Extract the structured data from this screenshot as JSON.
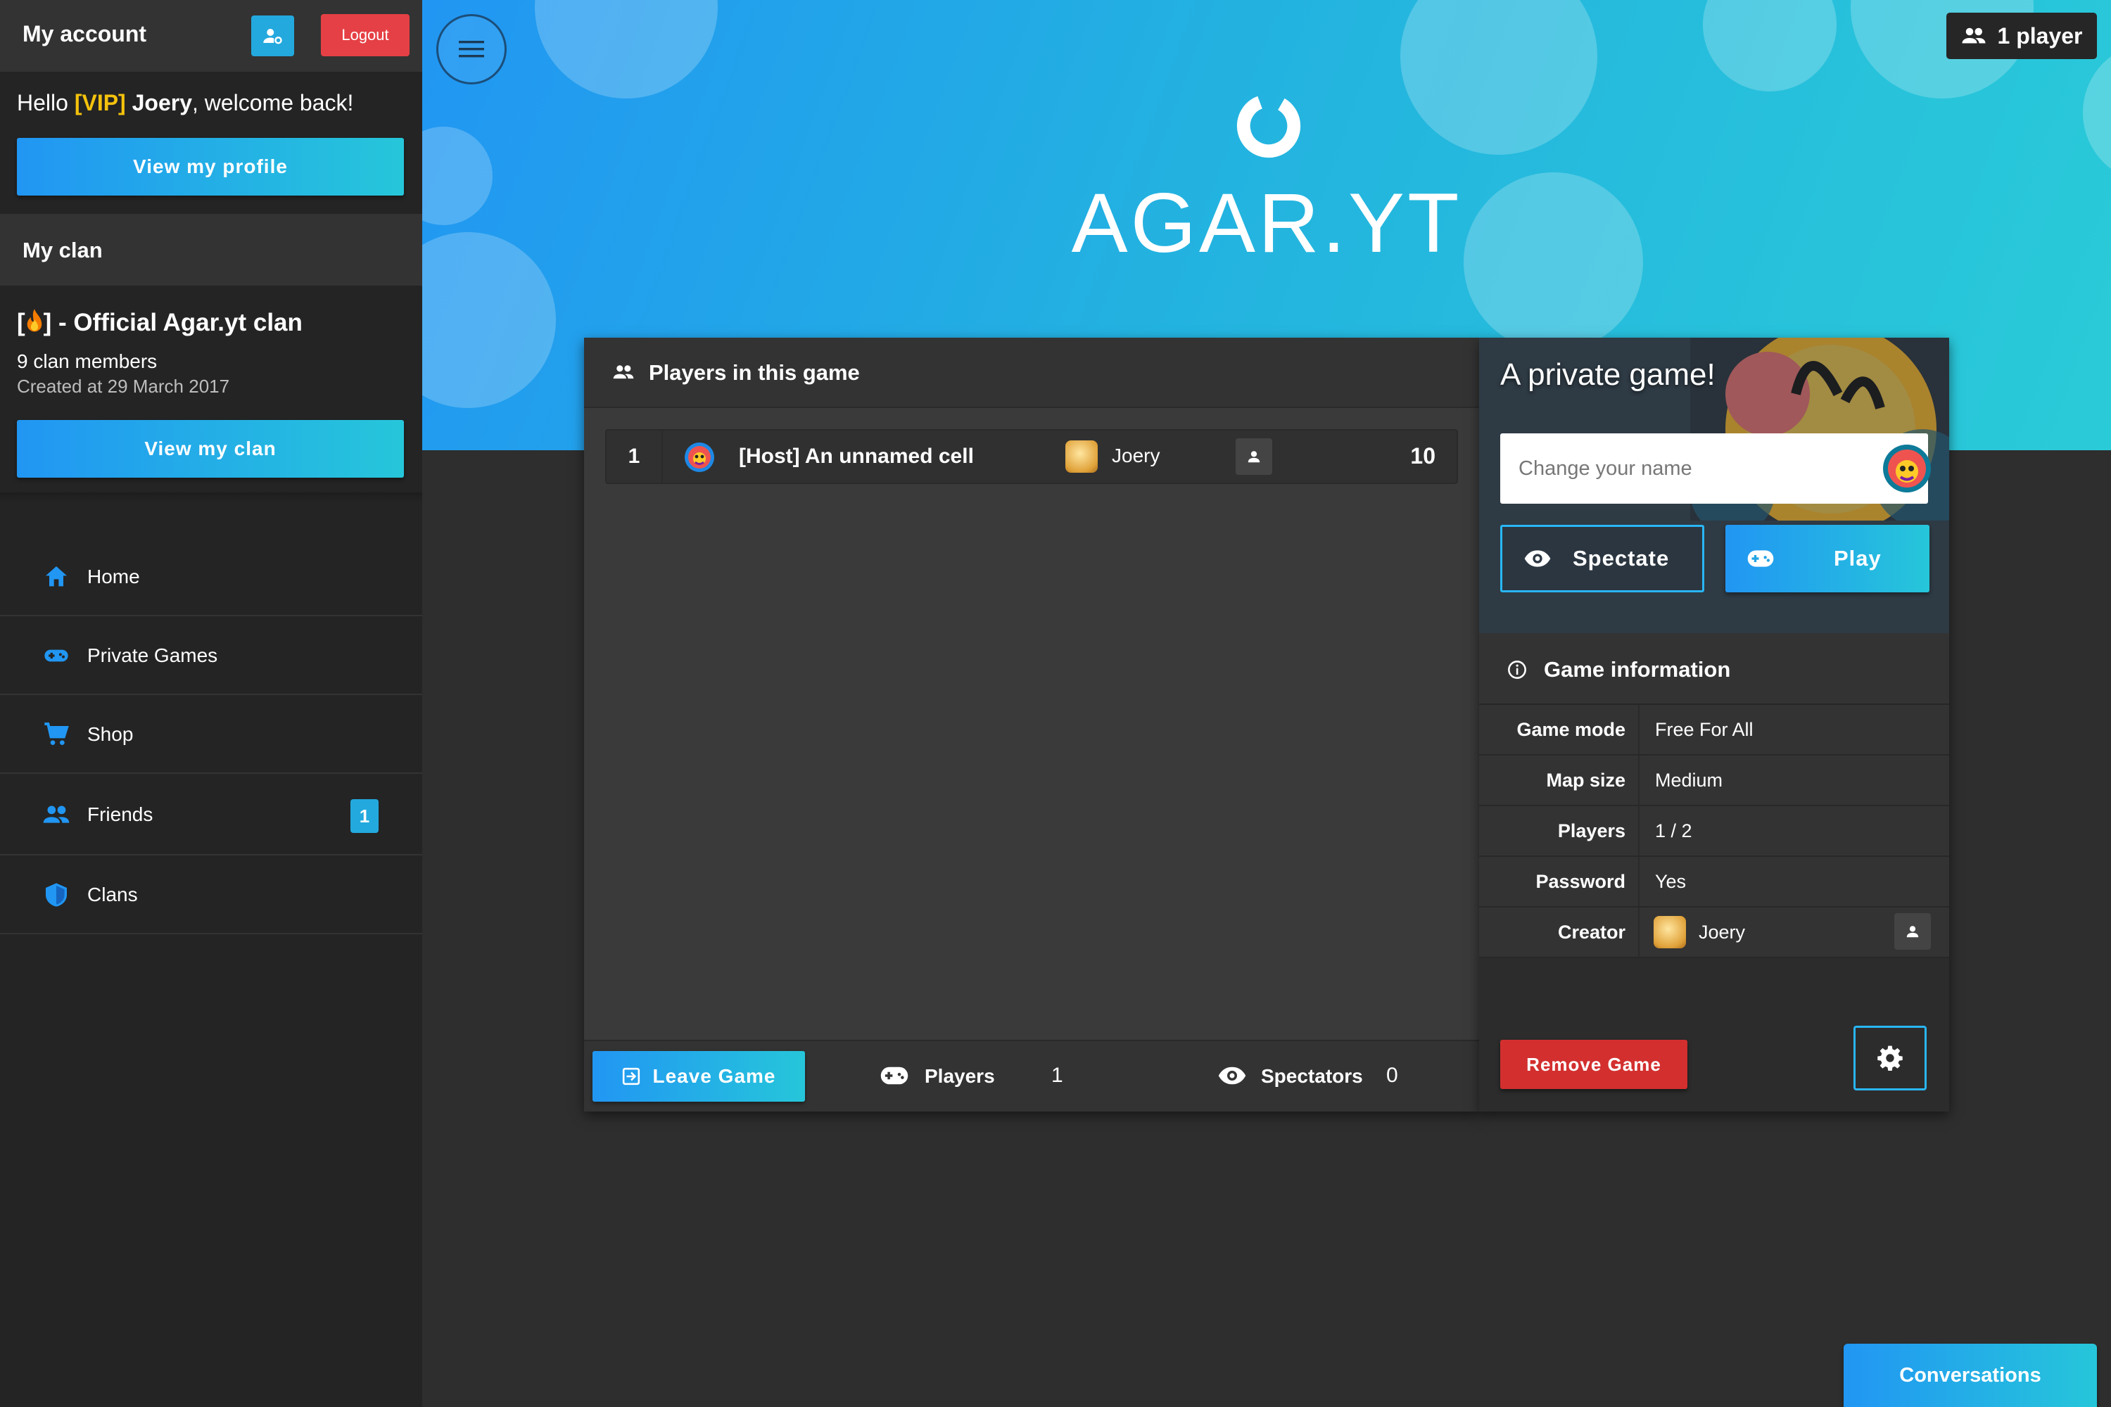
{
  "sidebar": {
    "account_title": "My account",
    "account_icon": "user-settings-icon",
    "logout_label": "Logout",
    "greeting": {
      "hello": "Hello ",
      "vip": "[VIP]",
      "name": "Joery",
      "rest": ", welcome back!"
    },
    "view_profile_label": "View my profile",
    "clan_header": "My clan",
    "clan": {
      "name_prefix": "[",
      "name_icon": "fire-emoji",
      "name_suffix": "] - Official Agar.yt clan",
      "members": "9 clan members",
      "created": "Created at 29 March 2017"
    },
    "view_clan_label": "View my clan",
    "nav": [
      {
        "label": "Home",
        "icon": "home-icon"
      },
      {
        "label": "Private Games",
        "icon": "gamepad-icon"
      },
      {
        "label": "Shop",
        "icon": "cart-icon"
      },
      {
        "label": "Friends",
        "icon": "people-icon",
        "badge": "1"
      },
      {
        "label": "Clans",
        "icon": "shield-icon"
      }
    ]
  },
  "header": {
    "menu_icon": "hamburger-icon",
    "logo_text": "AGAR.YT",
    "player_count": "1 player"
  },
  "players_panel": {
    "title": "Players in this game",
    "rows": [
      {
        "rank": "1",
        "name": "[Host] An unnamed cell",
        "owner": "Joery",
        "score": "10"
      }
    ],
    "leave_label": "Leave Game",
    "players_label": "Players",
    "players_value": "1",
    "spectators_label": "Spectators",
    "spectators_value": "0"
  },
  "game_card": {
    "title": "A private game!",
    "name_placeholder": "Change your name",
    "spectate_label": "Spectate",
    "play_label": "Play",
    "info_title": "Game information",
    "info": [
      {
        "key": "Game mode",
        "value": "Free For All"
      },
      {
        "key": "Map size",
        "value": "Medium"
      },
      {
        "key": "Players",
        "value": "1 / 2"
      },
      {
        "key": "Password",
        "value": "Yes"
      },
      {
        "key": "Creator",
        "value": "Joery"
      }
    ],
    "remove_label": "Remove Game",
    "settings_icon": "gear-icon"
  },
  "conversations_label": "Conversations",
  "colors": {
    "accent_blue": "#2196f3",
    "accent_cyan": "#26c6da",
    "danger": "#d32f2f",
    "vip": "#f4c20d",
    "sidebar_bg": "#242424",
    "panel_bg": "#3a3a3a"
  }
}
